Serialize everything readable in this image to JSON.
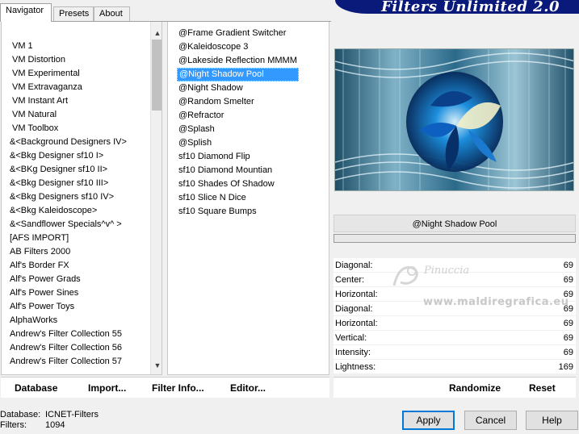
{
  "tabs": [
    {
      "label": "Navigator",
      "active": true
    },
    {
      "label": "Presets",
      "active": false
    },
    {
      "label": "About",
      "active": false
    }
  ],
  "banner_title": "Filters Unlimited 2.0",
  "categories": [
    "VM 1",
    "VM Distortion",
    "VM Experimental",
    "VM Extravaganza",
    "VM Instant Art",
    "VM Natural",
    "VM Toolbox",
    "&<Background Designers IV>",
    "&<Bkg Designer sf10 I>",
    "&<BKg Designer sf10 II>",
    "&<Bkg Designer sf10 III>",
    "&<Bkg Designers sf10 IV>",
    "&<Bkg Kaleidoscope>",
    "&<Sandflower Specials^v^ >",
    "[AFS IMPORT]",
    "AB Filters 2000",
    "Alf's Border FX",
    "Alf's Power Grads",
    "Alf's Power Sines",
    "Alf's Power Toys",
    "AlphaWorks",
    "Andrew's Filter Collection 55",
    "Andrew's Filter Collection 56",
    "Andrew's Filter Collection 57"
  ],
  "filters": [
    "@Frame Gradient Switcher",
    "@Kaleidoscope 3",
    "@Lakeside Reflection MMMM",
    "@Night Shadow Pool",
    "@Night Shadow",
    "@Random Smelter",
    "@Refractor",
    "@Splash",
    "@Splish",
    "sf10 Diamond Flip",
    "sf10 Diamond Mountian",
    "sf10 Shades Of Shadow",
    "sf10 Slice N Dice",
    "sf10 Square Bumps"
  ],
  "selected_filter_index": 3,
  "current_filter_name": "@Night Shadow Pool",
  "params": [
    {
      "label": "Diagonal:",
      "value": "69"
    },
    {
      "label": "Center:",
      "value": "69"
    },
    {
      "label": "Horizontal:",
      "value": "69"
    },
    {
      "label": "Diagonal:",
      "value": "69"
    },
    {
      "label": "Horizontal:",
      "value": "69"
    },
    {
      "label": "Vertical:",
      "value": "69"
    },
    {
      "label": "Intensity:",
      "value": "69"
    },
    {
      "label": "Lightness:",
      "value": "169"
    }
  ],
  "watermark": {
    "name": "Pinuccia",
    "url": "www.maldiregrafica.eu"
  },
  "bottom_left": {
    "database": "Database",
    "import": "Import...",
    "filter_info": "Filter Info...",
    "editor": "Editor..."
  },
  "bottom_right": {
    "randomize": "Randomize",
    "reset": "Reset"
  },
  "status": {
    "database_key": "Database:",
    "database_val": "ICNET-Filters",
    "filters_key": "Filters:",
    "filters_val": "1094"
  },
  "buttons": {
    "apply": "Apply",
    "cancel": "Cancel",
    "help": "Help"
  },
  "colors": {
    "banner": "#0a1a7a",
    "selection": "#3399ff",
    "default_button_border": "#0078d7"
  }
}
